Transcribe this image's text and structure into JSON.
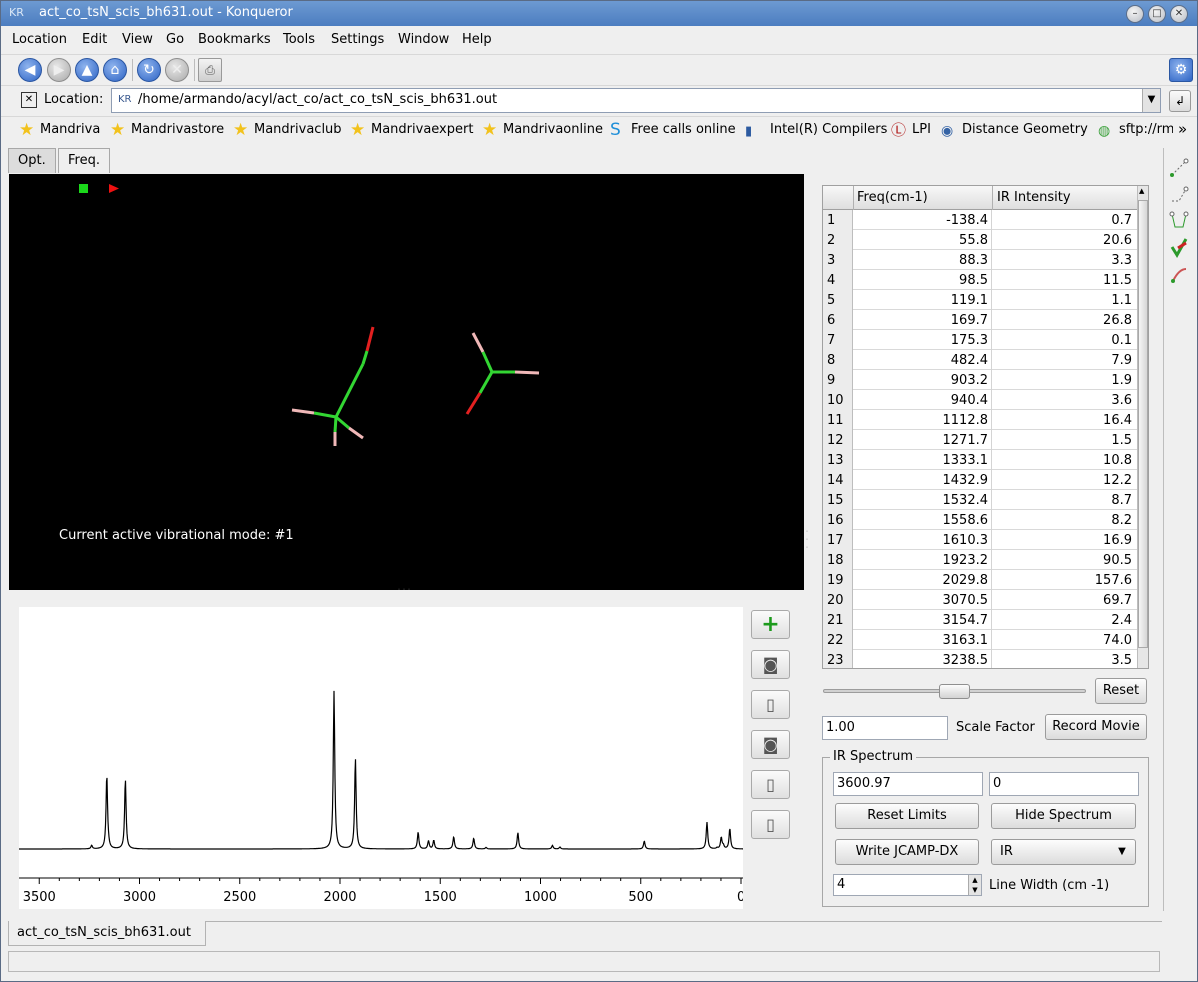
{
  "window": {
    "title": "act_co_tsN_scis_bh631.out - Konqueror"
  },
  "menu": [
    "Location",
    "Edit",
    "View",
    "Go",
    "Bookmarks",
    "Tools",
    "Settings",
    "Window",
    "Help"
  ],
  "location": {
    "label": "Location:",
    "url": "/home/armando/acyl/act_co/act_co_tsN_scis_bh631.out"
  },
  "bookmarks": [
    "Mandriva",
    "Mandrivastore",
    "Mandrivaclub",
    "Mandrivaexpert",
    "Mandrivaonline",
    "Free calls online",
    "Intel(R) Compilers",
    "LPI",
    "Distance Geometry",
    "sftp://rm"
  ],
  "tabs": [
    "Opt.",
    "Freq."
  ],
  "viewer": {
    "mode_text": "Current active vibrational mode: #1"
  },
  "table": {
    "headers": [
      "Freq(cm-1)",
      "IR Intensity"
    ],
    "rows": [
      [
        "1",
        "-138.4",
        "0.7"
      ],
      [
        "2",
        "55.8",
        "20.6"
      ],
      [
        "3",
        "88.3",
        "3.3"
      ],
      [
        "4",
        "98.5",
        "11.5"
      ],
      [
        "5",
        "119.1",
        "1.1"
      ],
      [
        "6",
        "169.7",
        "26.8"
      ],
      [
        "7",
        "175.3",
        "0.1"
      ],
      [
        "8",
        "482.4",
        "7.9"
      ],
      [
        "9",
        "903.2",
        "1.9"
      ],
      [
        "10",
        "940.4",
        "3.6"
      ],
      [
        "11",
        "1112.8",
        "16.4"
      ],
      [
        "12",
        "1271.7",
        "1.5"
      ],
      [
        "13",
        "1333.1",
        "10.8"
      ],
      [
        "14",
        "1432.9",
        "12.2"
      ],
      [
        "15",
        "1532.4",
        "8.7"
      ],
      [
        "16",
        "1558.6",
        "8.2"
      ],
      [
        "17",
        "1610.3",
        "16.9"
      ],
      [
        "18",
        "1923.2",
        "90.5"
      ],
      [
        "19",
        "2029.8",
        "157.6"
      ],
      [
        "20",
        "3070.5",
        "69.7"
      ],
      [
        "21",
        "3154.7",
        "2.4"
      ],
      [
        "22",
        "3163.1",
        "74.0"
      ],
      [
        "23",
        "3238.5",
        "3.5"
      ]
    ]
  },
  "controls": {
    "reset_label": "Reset",
    "scale_value": "1.00",
    "scale_label": "Scale Factor",
    "record_label": "Record Movie",
    "ir_group_title": "IR Spectrum",
    "limit_max": "3600.97",
    "limit_min": "0",
    "reset_limits_label": "Reset Limits",
    "hide_spectrum_label": "Hide Spectrum",
    "write_jcamp_label": "Write JCAMP-DX",
    "spectrum_type": "IR",
    "line_width_value": "4",
    "line_width_label": "Line Width (cm -1)"
  },
  "document_tab": "act_co_tsN_scis_bh631.out",
  "chart_data": {
    "type": "line",
    "title": "",
    "xlabel": "",
    "ylabel": "",
    "xlim": [
      3600.97,
      0
    ],
    "x_ticks": [
      "3500",
      "3000",
      "2500",
      "2000",
      "1500",
      "1000",
      "500",
      "0"
    ],
    "x_tick_values": [
      3500,
      3000,
      2500,
      2000,
      1500,
      1000,
      500,
      0
    ],
    "peaks": [
      {
        "x": 3238.5,
        "y": 3.5
      },
      {
        "x": 3163.1,
        "y": 74.0
      },
      {
        "x": 3154.7,
        "y": 2.4
      },
      {
        "x": 3070.5,
        "y": 69.7
      },
      {
        "x": 2029.8,
        "y": 157.6
      },
      {
        "x": 1923.2,
        "y": 90.5
      },
      {
        "x": 1610.3,
        "y": 16.9
      },
      {
        "x": 1558.6,
        "y": 8.2
      },
      {
        "x": 1532.4,
        "y": 8.7
      },
      {
        "x": 1432.9,
        "y": 12.2
      },
      {
        "x": 1333.1,
        "y": 10.8
      },
      {
        "x": 1271.7,
        "y": 1.5
      },
      {
        "x": 1112.8,
        "y": 16.4
      },
      {
        "x": 940.4,
        "y": 3.6
      },
      {
        "x": 903.2,
        "y": 1.9
      },
      {
        "x": 482.4,
        "y": 7.9
      },
      {
        "x": 175.3,
        "y": 0.1
      },
      {
        "x": 169.7,
        "y": 26.8
      },
      {
        "x": 119.1,
        "y": 1.1
      },
      {
        "x": 98.5,
        "y": 11.5
      },
      {
        "x": 88.3,
        "y": 3.3
      },
      {
        "x": 55.8,
        "y": 20.6
      }
    ],
    "line_width_cm": 4
  }
}
